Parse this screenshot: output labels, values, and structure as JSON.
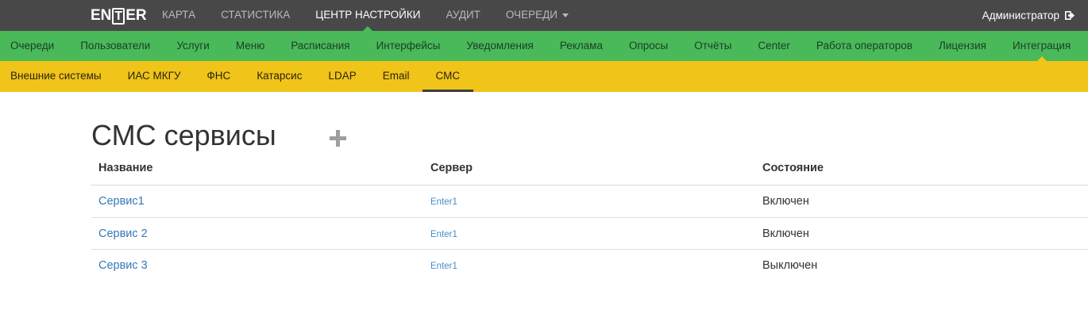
{
  "app": {
    "logo_parts": [
      "EN",
      "T",
      "ER"
    ],
    "logo_text": "ENTER"
  },
  "top_nav": {
    "items": [
      {
        "label": "КАРТА",
        "active": false
      },
      {
        "label": "СТАТИСТИКА",
        "active": false
      },
      {
        "label": "ЦЕНТР НАСТРОЙКИ",
        "active": true
      },
      {
        "label": "АУДИТ",
        "active": false
      },
      {
        "label": "ОЧЕРЕДИ",
        "active": false,
        "dropdown": true
      }
    ],
    "user_label": "Администратор",
    "logout_icon": "logout-icon"
  },
  "settings_nav": {
    "items": [
      {
        "label": "Очереди"
      },
      {
        "label": "Пользователи"
      },
      {
        "label": "Услуги"
      },
      {
        "label": "Меню"
      },
      {
        "label": "Расписания"
      },
      {
        "label": "Интерфейсы"
      },
      {
        "label": "Уведомления"
      },
      {
        "label": "Реклама"
      },
      {
        "label": "Опросы"
      },
      {
        "label": "Отчёты"
      },
      {
        "label": "Center"
      },
      {
        "label": "Работа операторов"
      },
      {
        "label": "Лицензия"
      },
      {
        "label": "Интеграция",
        "active": true
      }
    ]
  },
  "integration_nav": {
    "items": [
      {
        "label": "Внешние системы"
      },
      {
        "label": "ИАС МКГУ"
      },
      {
        "label": "ФНС"
      },
      {
        "label": "Катарсис"
      },
      {
        "label": "LDAP"
      },
      {
        "label": "Email"
      },
      {
        "label": "СМС",
        "active": true
      }
    ]
  },
  "main": {
    "title": "СМС сервисы",
    "add_icon": "plus-icon",
    "table": {
      "headers": [
        "Название",
        "Сервер",
        "Состояние"
      ],
      "rows": [
        {
          "name": "Сервис1",
          "server": "Enter1",
          "state": "Включен"
        },
        {
          "name": "Сервис 2",
          "server": "Enter1",
          "state": "Включен"
        },
        {
          "name": "Сервис 3",
          "server": "Enter1",
          "state": "Выключен"
        }
      ]
    }
  },
  "colors": {
    "topbar": "#484848",
    "green": "#49b95a",
    "yellow": "#f0c419",
    "link": "#337ab7"
  }
}
